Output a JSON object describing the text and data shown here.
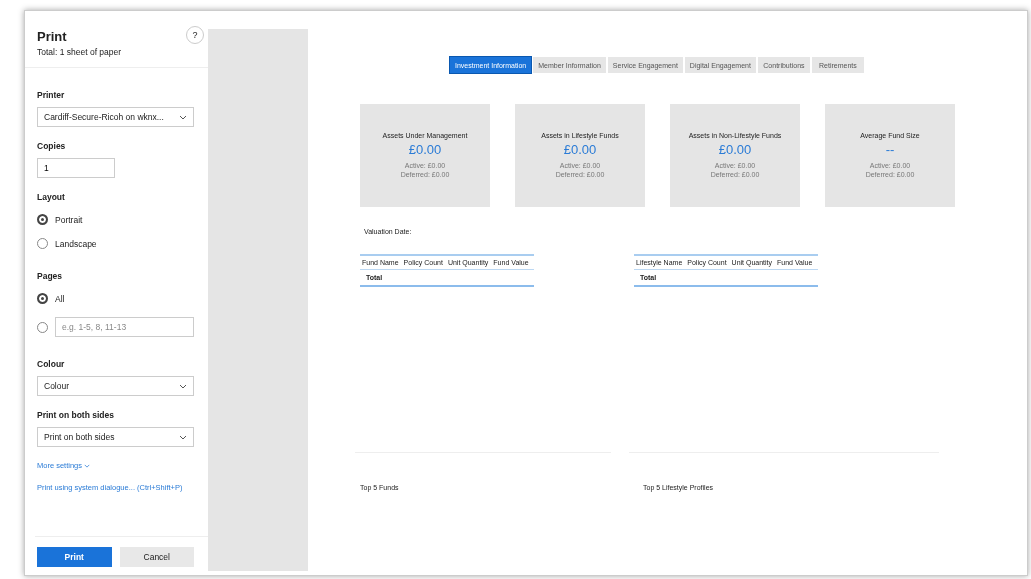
{
  "dialog": {
    "title": "Print",
    "subtitle": "Total: 1 sheet of paper",
    "help": "?",
    "printer": {
      "label": "Printer",
      "value": "Cardiff-Secure-Ricoh on wknx..."
    },
    "copies": {
      "label": "Copies",
      "value": "1"
    },
    "layout": {
      "label": "Layout",
      "options": [
        {
          "label": "Portrait",
          "selected": true
        },
        {
          "label": "Landscape",
          "selected": false
        }
      ]
    },
    "pages": {
      "label": "Pages",
      "options": [
        {
          "label": "All",
          "selected": true
        },
        {
          "placeholder": "e.g. 1-5, 8, 11-13",
          "selected": false
        }
      ]
    },
    "colour": {
      "label": "Colour",
      "value": "Colour"
    },
    "sides": {
      "label": "Print on both sides",
      "value": "Print on both sides"
    },
    "more_settings": "More settings",
    "system_dialog": "Print using system dialogue... (Ctrl+Shift+P)",
    "buttons": [
      {
        "label": "Print",
        "kind": "primary"
      },
      {
        "label": "Cancel",
        "kind": "secondary"
      }
    ]
  },
  "preview": {
    "tabs": [
      {
        "label": "Investment Information",
        "selected": true
      },
      {
        "label": "Member Information",
        "selected": false
      },
      {
        "label": "Service Engagement",
        "selected": false
      },
      {
        "label": "Digital Engagement",
        "selected": false
      },
      {
        "label": "Contributions",
        "selected": false
      },
      {
        "label": "Retirements",
        "selected": false
      }
    ],
    "cards": [
      {
        "title": "Assets Under Management",
        "value": "£0.00",
        "active": "Active: £0.00",
        "deferred": "Deferred: £0.00"
      },
      {
        "title": "Assets in Lifestyle Funds",
        "value": "£0.00",
        "active": "Active: £0.00",
        "deferred": "Deferred: £0.00"
      },
      {
        "title": "Assets in Non-Lifestyle Funds",
        "value": "£0.00",
        "active": "Active: £0.00",
        "deferred": "Deferred: £0.00"
      },
      {
        "title": "Average Fund Size",
        "value": "--",
        "active": "Active: £0.00",
        "deferred": "Deferred: £0.00"
      }
    ],
    "valuation_date": "Valuation Date:",
    "tables": [
      {
        "columns": [
          "Fund Name",
          "Policy Count",
          "Unit Quantity",
          "Fund Value"
        ],
        "total": "Total"
      },
      {
        "columns": [
          "Lifestyle Name",
          "Policy Count",
          "Unit Quantity",
          "Fund Value"
        ],
        "total": "Total"
      }
    ],
    "sections": [
      "Top 5 Funds",
      "Top 5 Lifestyle Profiles"
    ]
  }
}
